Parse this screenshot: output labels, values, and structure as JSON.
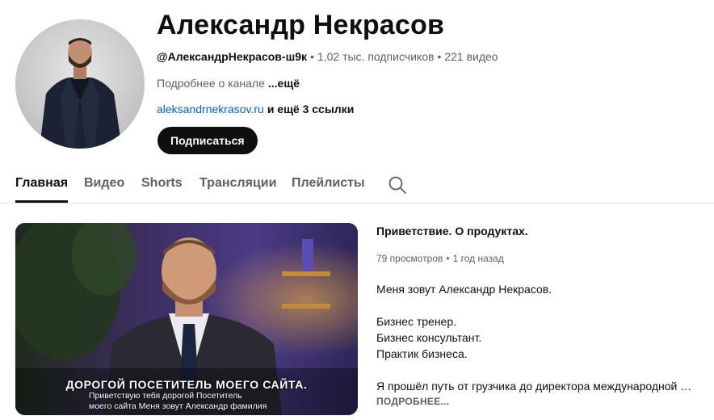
{
  "channel": {
    "name": "Александр Некрасов",
    "handle": "@АлександрНекрасов-ш9к",
    "subscribers": "1,02 тыс. подписчиков",
    "video_count": "221 видео",
    "about_prefix": "Подробнее о канале",
    "about_more": "...ещё",
    "link_url": "aleksandrnekrasov.ru",
    "link_extra": "и ещё 3 ссылки",
    "subscribe_label": "Подписаться"
  },
  "tabs": [
    {
      "label": "Главная",
      "active": true
    },
    {
      "label": "Видео",
      "active": false
    },
    {
      "label": "Shorts",
      "active": false
    },
    {
      "label": "Трансляции",
      "active": false
    },
    {
      "label": "Плейлисты",
      "active": false
    }
  ],
  "icons": {
    "search": "search-icon"
  },
  "featured_video": {
    "title": "Приветствие. О продуктах.",
    "views": "79 просмотров",
    "age": "1 год назад",
    "caption_title": "ДОРОГОЙ ПОСЕТИТЕЛЬ МОЕГО САЙТА.",
    "caption_lines": [
      "Приветствую тебя дорогой Посетитель",
      "моего сайта Меня зовут Александр фамилия"
    ],
    "description": [
      "Меня зовут Александр Некрасов.",
      "",
      "Бизнес тренер.",
      "Бизнес консультант.",
      "Практик бизнеса.",
      "",
      "Я прошёл путь от грузчика до директора международной …"
    ],
    "more_label": "ПОДРОБНЕЕ..."
  },
  "colors": {
    "link": "#065fd4",
    "subscribe_bg": "#0f0f0f",
    "secondary_text": "#606060"
  }
}
